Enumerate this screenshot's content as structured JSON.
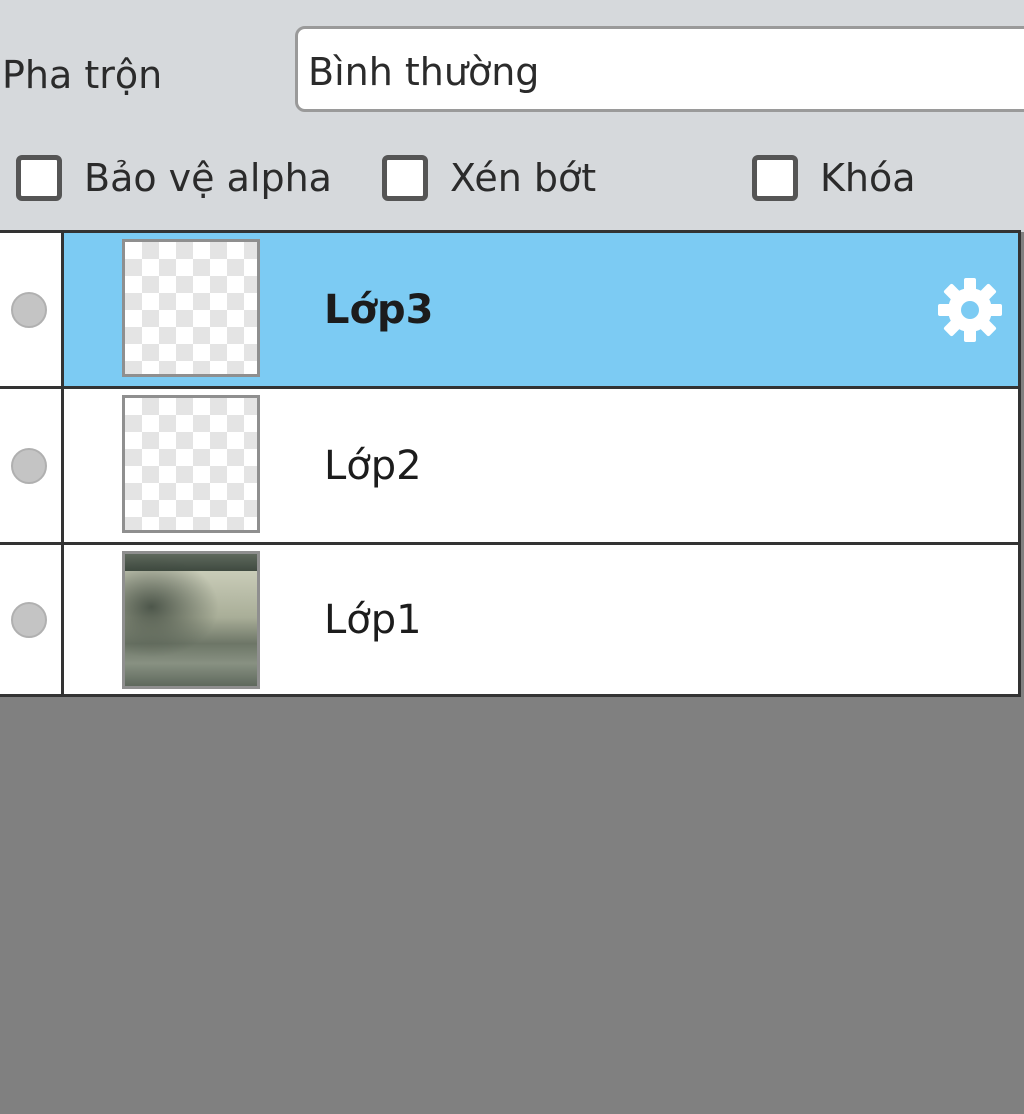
{
  "blend": {
    "label": "Pha trộn",
    "value": "Bình thường"
  },
  "options": {
    "protect_alpha": {
      "label": "Bảo vệ alpha",
      "checked": false
    },
    "clipping": {
      "label": "Xén bớt",
      "checked": false
    },
    "lock": {
      "label": "Khóa",
      "checked": false
    }
  },
  "layers": [
    {
      "name": "Lớp3",
      "selected": true,
      "thumbnail": "transparent-checker"
    },
    {
      "name": "Lớp2",
      "selected": false,
      "thumbnail": "transparent-checker"
    },
    {
      "name": "Lớp1",
      "selected": false,
      "thumbnail": "foggy-landscape-photo"
    }
  ],
  "selected_layer_icon": "gear-icon",
  "colors": {
    "panel_bg": "#d6d9dc",
    "selected_row": "#7ccbf3",
    "empty_area": "#808080"
  }
}
